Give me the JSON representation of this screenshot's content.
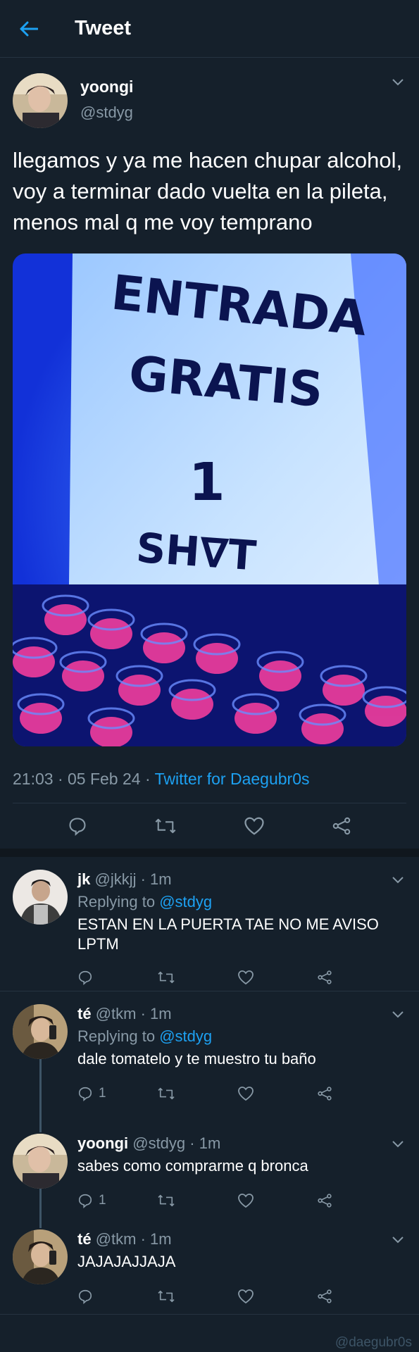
{
  "header": {
    "title": "Tweet"
  },
  "tweet": {
    "name": "yoongi",
    "handle": "@stdyg",
    "text": "llegamos y ya me hacen chupar alcohol, voy a terminar dado vuelta en la pileta, menos mal q me voy temprano",
    "image_text": [
      "ENTRADA",
      "GRATIS",
      "1",
      "SH∇T"
    ],
    "time": "21:03 · 05 Feb 24 ·",
    "source": "Twitter for Daegubr0s"
  },
  "replies": [
    {
      "name": "jk",
      "handle": "@jkkjj",
      "time": "· 1m",
      "replying_prefix": "Replying to",
      "replying_to": "@stdyg",
      "text": "ESTAN EN LA PUERTA TAE NO ME AVISO LPTM",
      "reply_count": ""
    },
    {
      "name": "té",
      "handle": "@tkm",
      "time": "· 1m",
      "replying_prefix": "Replying to",
      "replying_to": "@stdyg",
      "text": "dale tomatelo y te muestro tu baño",
      "reply_count": "1"
    },
    {
      "name": "yoongi",
      "handle": "@stdyg",
      "time": "· 1m",
      "text": "sabes como comprarme q bronca",
      "reply_count": "1"
    },
    {
      "name": "té",
      "handle": "@tkm",
      "time": "· 1m",
      "text": "JAJAJAJJAJA",
      "reply_count": ""
    }
  ],
  "watermark": "@daegubr0s",
  "colors": {
    "background": "#15202b",
    "accent": "#1da1f2",
    "muted": "#8899a6",
    "border": "#253341"
  }
}
